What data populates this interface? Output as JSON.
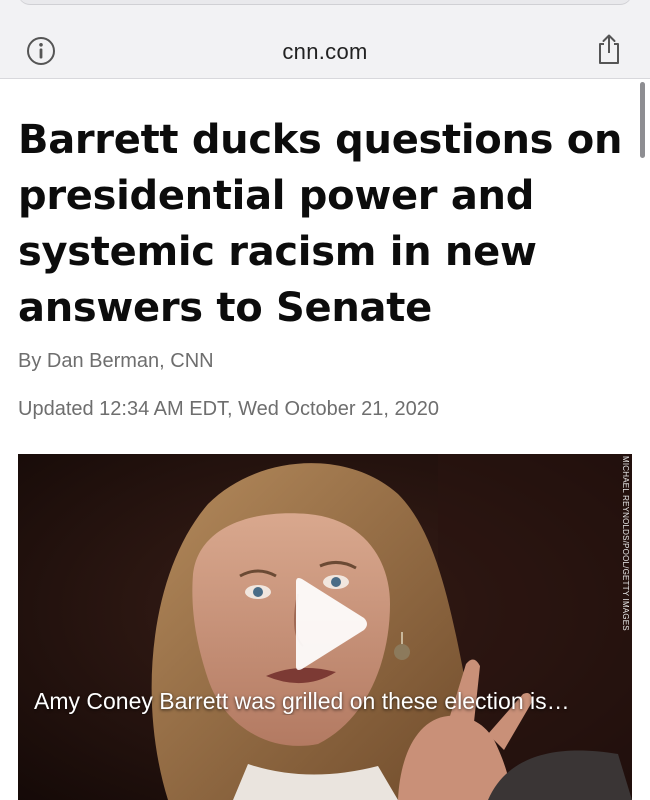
{
  "browser": {
    "url": "cnn.com",
    "info_icon": "info-circle-icon",
    "share_icon": "share-icon"
  },
  "article": {
    "headline": "Barrett ducks questions on presidential power and systemic racism in new answers to Senate",
    "byline": "By Dan Berman, CNN",
    "updated": "Updated 12:34 AM EDT, Wed October 21, 2020"
  },
  "video": {
    "credit": "MICHAEL REYNOLDS/POOL/GETTY IMAGES",
    "caption": "Amy Coney Barrett was grilled on these election is…",
    "play_icon": "play-icon"
  },
  "colors": {
    "toolbar_bg": "#f2f2f4",
    "headline": "#0c0c0c",
    "meta_text": "#6e6e6e"
  }
}
